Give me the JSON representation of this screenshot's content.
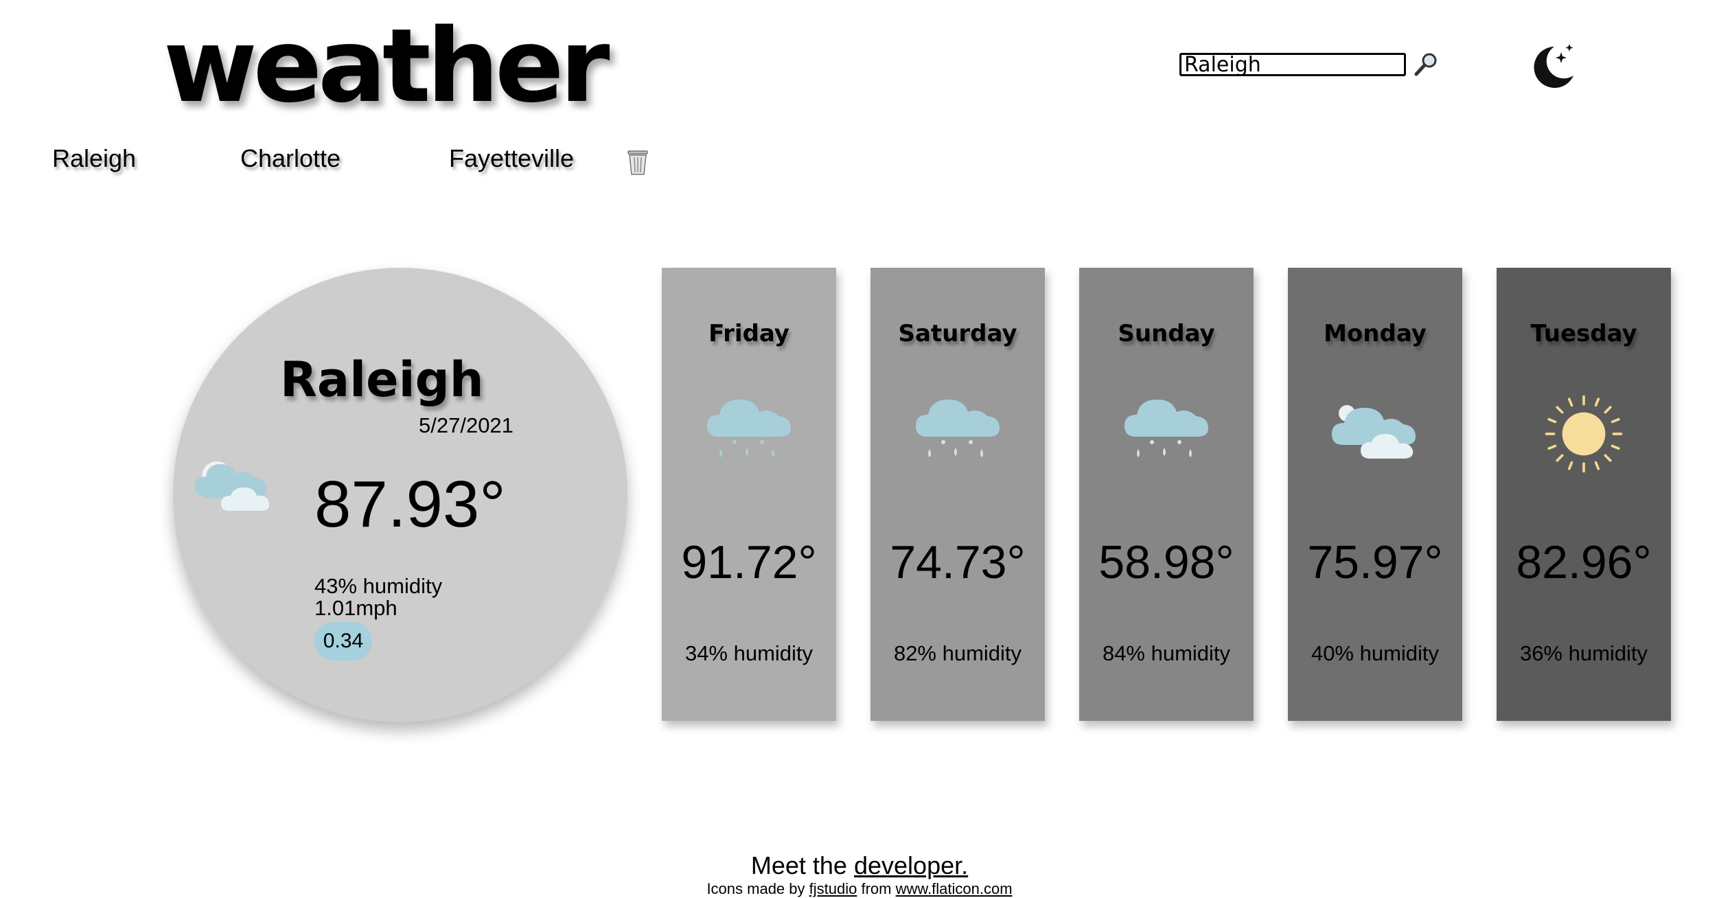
{
  "header": {
    "title": "weather"
  },
  "search": {
    "value": "Raleigh"
  },
  "recent_cities": [
    "Raleigh",
    "Charlotte",
    "Fayetteville"
  ],
  "current": {
    "city": "Raleigh",
    "date": "5/27/2021",
    "temp": "87.93°",
    "humidity": "43% humidity",
    "wind": "1.01mph",
    "uv": "0.34",
    "icon": "partly-cloudy-icon"
  },
  "forecast": [
    {
      "day": "Friday",
      "temp": "91.72°",
      "humidity": "34% humidity",
      "icon": "rain-icon",
      "bg": "#adadad"
    },
    {
      "day": "Saturday",
      "temp": "74.73°",
      "humidity": "82% humidity",
      "icon": "rain-icon",
      "bg": "#9a9a9a"
    },
    {
      "day": "Sunday",
      "temp": "58.98°",
      "humidity": "84% humidity",
      "icon": "rain-icon",
      "bg": "#868686"
    },
    {
      "day": "Monday",
      "temp": "75.97°",
      "humidity": "40% humidity",
      "icon": "clouds-icon",
      "bg": "#6f6f6f"
    },
    {
      "day": "Tuesday",
      "temp": "82.96°",
      "humidity": "36% humidity",
      "icon": "sun-icon",
      "bg": "#5b5b5b"
    }
  ],
  "footer": {
    "meet_prefix": "Meet the",
    "developer_link": "developer.",
    "icons_prefix": "Icons made by",
    "author_link": "fjstudio",
    "from_text": "from",
    "site_link": "www.flaticon.com"
  },
  "colors": {
    "uv_badge": "#a5d0dd",
    "current_bg": "#cdcdcd",
    "cloud": "#a7cfda"
  }
}
